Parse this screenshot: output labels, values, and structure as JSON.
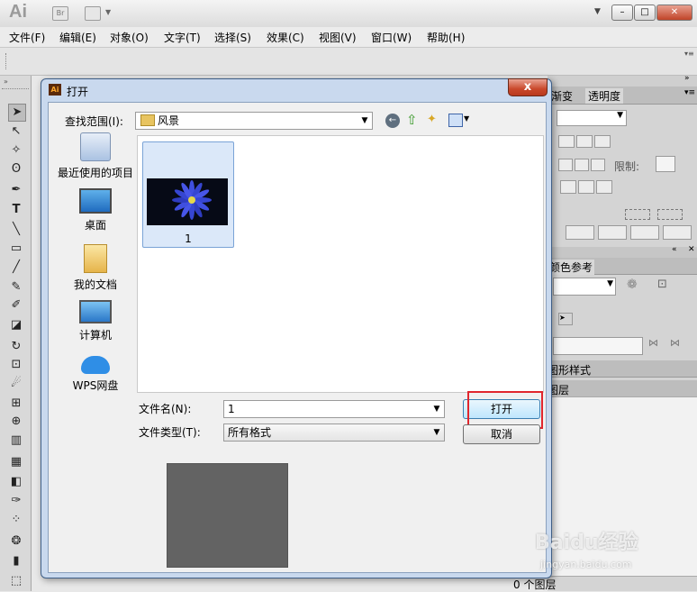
{
  "app": {
    "logo": "Ai",
    "bridge_label": "Br"
  },
  "menu": [
    "文件(F)",
    "编辑(E)",
    "对象(O)",
    "文字(T)",
    "选择(S)",
    "效果(C)",
    "视图(V)",
    "窗口(W)",
    "帮助(H)"
  ],
  "panels": {
    "tab_gradient": "渐变",
    "tab_transparency": "透明度",
    "limit_label": "限制:",
    "tab_color_guide": "颜色参考",
    "tab_graphic_styles": "图形样式",
    "tab_layers": "图层",
    "layers_count": "0 个图层"
  },
  "dialog": {
    "title": "打开",
    "close": "x",
    "look_in_label": "查找范围(I):",
    "look_in_value": "风景",
    "places": [
      "最近使用的项目",
      "桌面",
      "我的文档",
      "计算机",
      "WPS网盘"
    ],
    "files": [
      {
        "name": "1"
      }
    ],
    "filename_label": "文件名(N):",
    "filename_value": "1",
    "filetype_label": "文件类型(T):",
    "filetype_value": "所有格式",
    "open_button": "打开",
    "cancel_button": "取消"
  },
  "watermark": {
    "brand": "Baidu经验",
    "url": "jingyan.baidu.com"
  },
  "colors": {
    "accent_highlight": "#e0262d",
    "dialog_frame": "#c9d9ee",
    "close_red": "#c9482b"
  }
}
